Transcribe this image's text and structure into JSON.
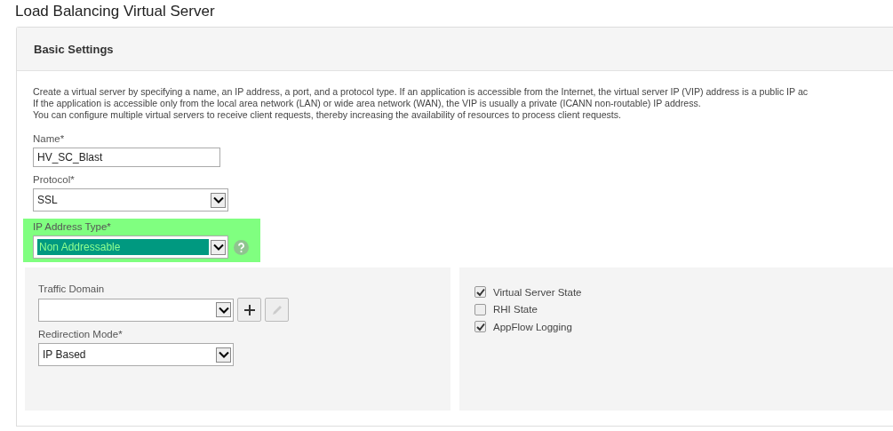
{
  "page_title": "Load Balancing Virtual Server",
  "section": {
    "title": "Basic Settings",
    "description": [
      "Create a virtual server by specifying a name, an IP address, a port, and a protocol type. If an application is accessible from the Internet, the virtual server IP (VIP) address is a public IP ac",
      "If the application is accessible only from the local area network (LAN) or wide area network (WAN), the VIP is usually a private (ICANN non-routable) IP address.",
      "You can configure multiple virtual servers to receive client requests, thereby increasing the availability of resources to process client requests."
    ]
  },
  "fields": [
    {
      "kind": "text",
      "label": "Name*",
      "value": "HV_SC_Blast"
    },
    {
      "kind": "select",
      "label": "Protocol*",
      "value": "SSL"
    },
    {
      "kind": "select",
      "label": "IP Address Type*",
      "value": "Non Addressable",
      "highlighted": true,
      "help": true
    }
  ],
  "left_panel": [
    {
      "kind": "select",
      "label": "Traffic Domain",
      "add_button": true,
      "edit_button": true
    },
    {
      "kind": "select",
      "label": "Redirection Mode*",
      "value": "IP Based"
    }
  ],
  "right_panel": [
    {
      "label": "Virtual Server State",
      "checked": true
    },
    {
      "label": "RHI State",
      "checked": false
    },
    {
      "label": "AppFlow Logging",
      "checked": true
    }
  ]
}
